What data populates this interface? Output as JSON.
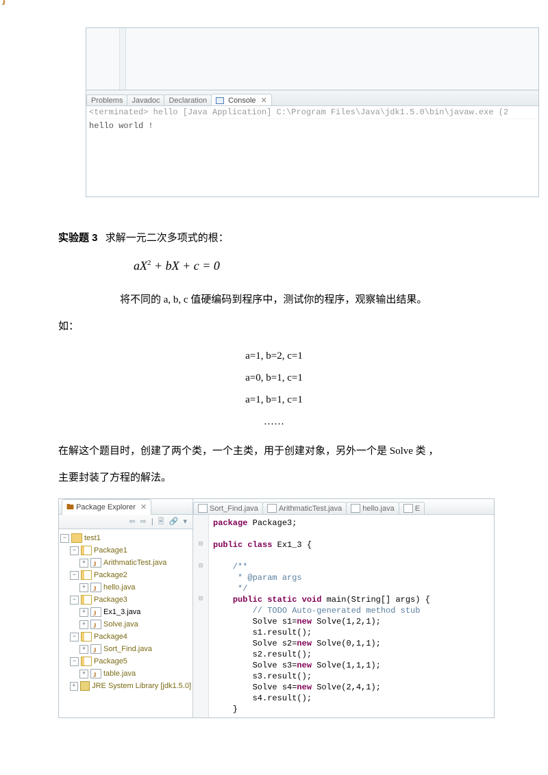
{
  "console": {
    "tabs": [
      "Problems",
      "Javadoc",
      "Declaration"
    ],
    "activeTab": "Console",
    "activeTabClose": "✕",
    "termLine": "<terminated> hello [Java Application] C:\\Program Files\\Java\\jdk1.5.0\\bin\\javaw.exe (2",
    "output": "hello world !"
  },
  "text": {
    "exTitle": "实验题 3",
    "exDesc": "求解一元二次多项式的根：",
    "formula_a": "aX",
    "formula_sup": "2",
    "formula_rest": " + bX + c = 0",
    "para1a": "将不同的 a, b, c 值硬编码到程序中，测试你的程序，观察输出结果。",
    "para1b": "如：",
    "ex_line1": "a=1, b=2, c=1",
    "ex_line2": "a=0, b=1, c=1",
    "ex_line3": "a=1, b=1, c=1",
    "dots": "……",
    "para2": "在解这个题目时，创建了两个类，一个主类，用于创建对象，另外一个是 Solve 类   ，",
    "para3": "主要封装了方程的解法。"
  },
  "ide": {
    "pkgTitle": "Package Explorer",
    "toolbarGlyphs": [
      "⇦",
      "⇨",
      "|",
      "🖹",
      "🔗",
      "▾"
    ],
    "tree": {
      "project": "test1",
      "packages": [
        {
          "name": "Package1",
          "files": [
            "ArithmaticTest.java"
          ]
        },
        {
          "name": "Package2",
          "files": [
            "hello.java"
          ]
        },
        {
          "name": "Package3",
          "files": [
            "Ex1_3.java",
            "Solve.java"
          ]
        },
        {
          "name": "Package4",
          "files": [
            "Sort_Find.java"
          ]
        },
        {
          "name": "Package5",
          "files": [
            "table.java"
          ]
        }
      ],
      "jre": "JRE System Library [jdk1.5.0]"
    },
    "editorTabs": [
      "Sort_Find.java",
      "ArithmaticTest.java",
      "hello.java",
      "E"
    ],
    "code": {
      "l1a": "package",
      "l1b": " Package3;",
      "l3a": "public class",
      "l3b": " Ex1_3 {",
      "l5": "    /**",
      "l6": "     * @param args",
      "l7": "     */",
      "l8a": "    ",
      "l8b": "public static void",
      "l8c": " main(String[] args) {",
      "l9": "        // TODO Auto-generated method stub",
      "l10a": "        Solve s1=",
      "l10b": "new",
      "l10c": " Solve(1,2,1);",
      "l11": "        s1.result();",
      "l12a": "        Solve s2=",
      "l12b": "new",
      "l12c": " Solve(0,1,1);",
      "l13": "        s2.result();",
      "l14a": "        Solve s3=",
      "l14b": "new",
      "l14c": " Solve(1,1,1);",
      "l15": "        s3.result();",
      "l16a": "        Solve s4=",
      "l16b": "new",
      "l16c": " Solve(2,4,1);",
      "l17": "        s4.result();",
      "l18": "    }"
    }
  }
}
